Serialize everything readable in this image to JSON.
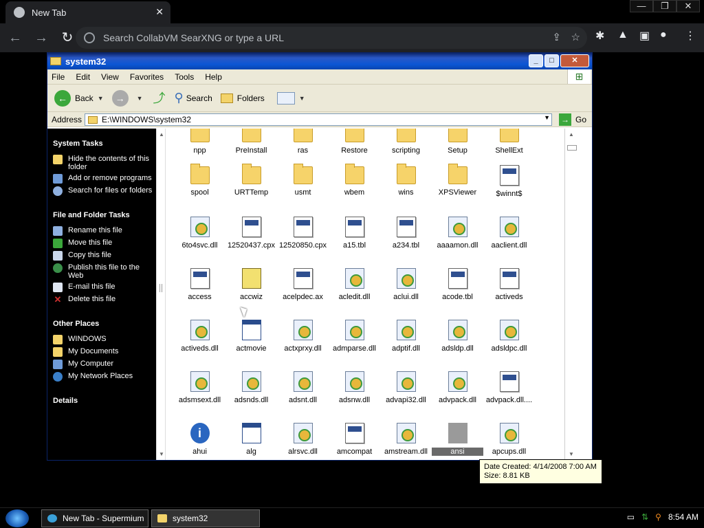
{
  "browser": {
    "tab_title": "New Tab",
    "tab_close": "✕",
    "omnibox_placeholder": "Search CollabVM SearXNG or type a URL",
    "window_min": "—",
    "window_max": "❐",
    "window_close": "✕"
  },
  "explorer": {
    "title": "system32",
    "menu": [
      "File",
      "Edit",
      "View",
      "Favorites",
      "Tools",
      "Help"
    ],
    "toolbar": {
      "back": "Back",
      "search": "Search",
      "folders": "Folders"
    },
    "address_label": "Address",
    "address_value": "E:\\WINDOWS\\system32",
    "go": "Go",
    "sections": {
      "system_tasks": "System Tasks",
      "file_tasks": "File and Folder Tasks",
      "other_places": "Other Places",
      "details": "Details"
    },
    "system_tasks": [
      "Hide the contents of this folder",
      "Add or remove programs",
      "Search for files or folders"
    ],
    "file_tasks": [
      "Rename this file",
      "Move this file",
      "Copy this file",
      "Publish this file to the Web",
      "E-mail this file",
      "Delete this file"
    ],
    "other_places": [
      "WINDOWS",
      "My Documents",
      "My Computer",
      "My Network Places"
    ],
    "rows": [
      [
        {
          "name": "npp",
          "kind": "folder"
        },
        {
          "name": "PreInstall",
          "kind": "folder"
        },
        {
          "name": "ras",
          "kind": "folder"
        },
        {
          "name": "Restore",
          "kind": "folder"
        },
        {
          "name": "scripting",
          "kind": "folder"
        },
        {
          "name": "Setup",
          "kind": "folder"
        },
        {
          "name": "ShellExt",
          "kind": "folder"
        }
      ],
      [
        {
          "name": "spool",
          "kind": "folder"
        },
        {
          "name": "URTTemp",
          "kind": "folder"
        },
        {
          "name": "usmt",
          "kind": "folder"
        },
        {
          "name": "wbem",
          "kind": "folder"
        },
        {
          "name": "wins",
          "kind": "folder"
        },
        {
          "name": "XPSViewer",
          "kind": "folder"
        },
        {
          "name": "$winnt$",
          "kind": "doc"
        }
      ],
      [
        {
          "name": "6to4svc.dll",
          "kind": "dll"
        },
        {
          "name": "12520437.cpx",
          "kind": "doc"
        },
        {
          "name": "12520850.cpx",
          "kind": "doc"
        },
        {
          "name": "a15.tbl",
          "kind": "doc"
        },
        {
          "name": "a234.tbl",
          "kind": "doc"
        },
        {
          "name": "aaaamon.dll",
          "kind": "dll"
        },
        {
          "name": "aaclient.dll",
          "kind": "dll"
        }
      ],
      [
        {
          "name": "access",
          "kind": "doc"
        },
        {
          "name": "accwiz",
          "kind": "wiz"
        },
        {
          "name": "acelpdec.ax",
          "kind": "doc"
        },
        {
          "name": "acledit.dll",
          "kind": "dll"
        },
        {
          "name": "aclui.dll",
          "kind": "dll"
        },
        {
          "name": "acode.tbl",
          "kind": "doc"
        },
        {
          "name": "activeds",
          "kind": "doc"
        }
      ],
      [
        {
          "name": "activeds.dll",
          "kind": "dll"
        },
        {
          "name": "actmovie",
          "kind": "app"
        },
        {
          "name": "actxprxy.dll",
          "kind": "dll"
        },
        {
          "name": "admparse.dll",
          "kind": "dll"
        },
        {
          "name": "adptif.dll",
          "kind": "dll"
        },
        {
          "name": "adsldp.dll",
          "kind": "dll"
        },
        {
          "name": "adsldpc.dll",
          "kind": "dll"
        }
      ],
      [
        {
          "name": "adsmsext.dll",
          "kind": "dll"
        },
        {
          "name": "adsnds.dll",
          "kind": "dll"
        },
        {
          "name": "adsnt.dll",
          "kind": "dll"
        },
        {
          "name": "adsnw.dll",
          "kind": "dll"
        },
        {
          "name": "advapi32.dll",
          "kind": "dll"
        },
        {
          "name": "advpack.dll",
          "kind": "dll"
        },
        {
          "name": "advpack.dll....",
          "kind": "doc"
        }
      ],
      [
        {
          "name": "ahui",
          "kind": "info"
        },
        {
          "name": "alg",
          "kind": "app"
        },
        {
          "name": "alrsvc.dll",
          "kind": "dll"
        },
        {
          "name": "amcompat",
          "kind": "doc"
        },
        {
          "name": "amstream.dll",
          "kind": "dll"
        },
        {
          "name": "ansi",
          "kind": "sel"
        },
        {
          "name": "apcups.dll",
          "kind": "dll"
        }
      ]
    ],
    "tooltip": {
      "line1": "Date Created: 4/14/2008 7:00 AM",
      "line2": "Size: 8.81 KB"
    }
  },
  "taskbar": {
    "items": [
      "New Tab - Supermium",
      "system32"
    ],
    "clock": "8:54 AM"
  }
}
